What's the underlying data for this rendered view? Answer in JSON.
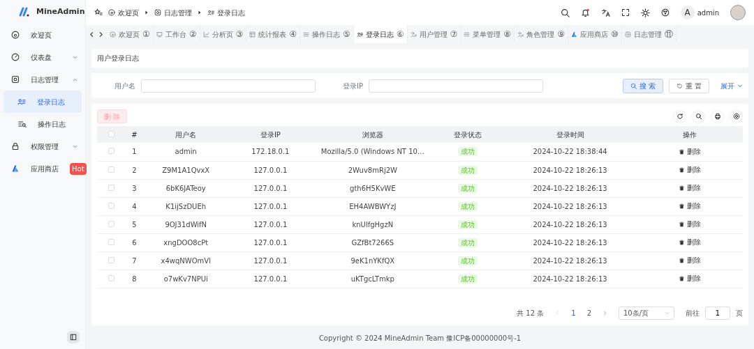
{
  "brand": {
    "name": "MineAdmin"
  },
  "sidebar": {
    "items": [
      {
        "label": "欢迎页",
        "selected": false
      },
      {
        "label": "仪表盘",
        "selected": false,
        "expanded": false
      },
      {
        "label": "日志管理",
        "selected": false,
        "expanded": true,
        "children": [
          {
            "label": "登录日志",
            "selected": true
          },
          {
            "label": "操作日志",
            "selected": false
          }
        ]
      },
      {
        "label": "权限管理",
        "selected": false,
        "expanded": false
      },
      {
        "label": "应用商店",
        "selected": false,
        "badge": "Hot"
      }
    ]
  },
  "breadcrumb": [
    "欢迎页",
    "日志管理",
    "登录日志"
  ],
  "user": {
    "avatar_letter": "A",
    "name": "admin"
  },
  "tabs": [
    {
      "label": "欢迎页",
      "num": "①",
      "selected": false
    },
    {
      "label": "工作台",
      "num": "②",
      "selected": false
    },
    {
      "label": "分析页",
      "num": "③",
      "selected": false
    },
    {
      "label": "统计报表",
      "num": "④",
      "selected": false
    },
    {
      "label": "操作日志",
      "num": "⑤",
      "selected": false
    },
    {
      "label": "登录日志",
      "num": "⑥",
      "selected": true
    },
    {
      "label": "用户管理",
      "num": "⑦",
      "selected": false
    },
    {
      "label": "菜单管理",
      "num": "⑧",
      "selected": false
    },
    {
      "label": "角色管理",
      "num": "⑨",
      "selected": false
    },
    {
      "label": "应用商店",
      "num": "⑩",
      "selected": false
    },
    {
      "label": "日志管理",
      "num": "⑪",
      "selected": false
    }
  ],
  "page_title": "用户登录日志",
  "search": {
    "fields": [
      {
        "label": "用户名"
      },
      {
        "label": "登录IP"
      }
    ],
    "buttons": [
      "搜 索",
      "重 置"
    ],
    "expand": "展开"
  },
  "delete_button": {
    "label": "删 除",
    "disabled": true
  },
  "table": {
    "select_all_checked": false,
    "columns": [
      "#",
      "用户名",
      "登录IP",
      "浏览器",
      "登录状态",
      "登录时间",
      "操作"
    ],
    "rows": [
      {
        "checked": false,
        "cells": [
          "1",
          "admin",
          "172.18.0.1",
          "Mozilla/5.0 (Windows NT 10…",
          "成功",
          "2024-10-22 18:38:44",
          "删除"
        ]
      },
      {
        "checked": false,
        "cells": [
          "2",
          "Z9M1A1QvxX",
          "127.0.0.1",
          "2Wuv8mRj2W",
          "成功",
          "2024-10-22 18:26:13",
          "删除"
        ]
      },
      {
        "checked": false,
        "cells": [
          "3",
          "6bK6JATeoy",
          "127.0.0.1",
          "gth6H5KvWE",
          "成功",
          "2024-10-22 18:26:13",
          "删除"
        ]
      },
      {
        "checked": false,
        "cells": [
          "4",
          "K1ijSzDUEh",
          "127.0.0.1",
          "EH4AWBWYzJ",
          "成功",
          "2024-10-22 18:26:13",
          "删除"
        ]
      },
      {
        "checked": false,
        "cells": [
          "5",
          "9OJ31dWifN",
          "127.0.0.1",
          "knUlfgHgzN",
          "成功",
          "2024-10-22 18:26:13",
          "删除"
        ]
      },
      {
        "checked": false,
        "cells": [
          "6",
          "xngDOO8cPt",
          "127.0.0.1",
          "GZfBt7266S",
          "成功",
          "2024-10-22 18:26:13",
          "删除"
        ]
      },
      {
        "checked": false,
        "cells": [
          "7",
          "x4wqNWOmVl",
          "127.0.0.1",
          "9eK1nYKfQX",
          "成功",
          "2024-10-22 18:26:13",
          "删除"
        ]
      },
      {
        "checked": false,
        "cells": [
          "8",
          "o7wKv7NPUi",
          "127.0.0.1",
          "uKTgcLTmkp",
          "成功",
          "2024-10-22 18:26:13",
          "删除"
        ]
      }
    ]
  },
  "pagination": {
    "total": "共 12 条",
    "pages": [
      {
        "label": "1",
        "selected": true
      },
      {
        "label": "2",
        "selected": false
      }
    ],
    "page_size": "10条/页",
    "goto_label": "前往",
    "goto_value": "1",
    "goto_unit": "页"
  },
  "footer": "Copyright © 2024 MineAdmin Team 豫ICP备00000000号-1"
}
